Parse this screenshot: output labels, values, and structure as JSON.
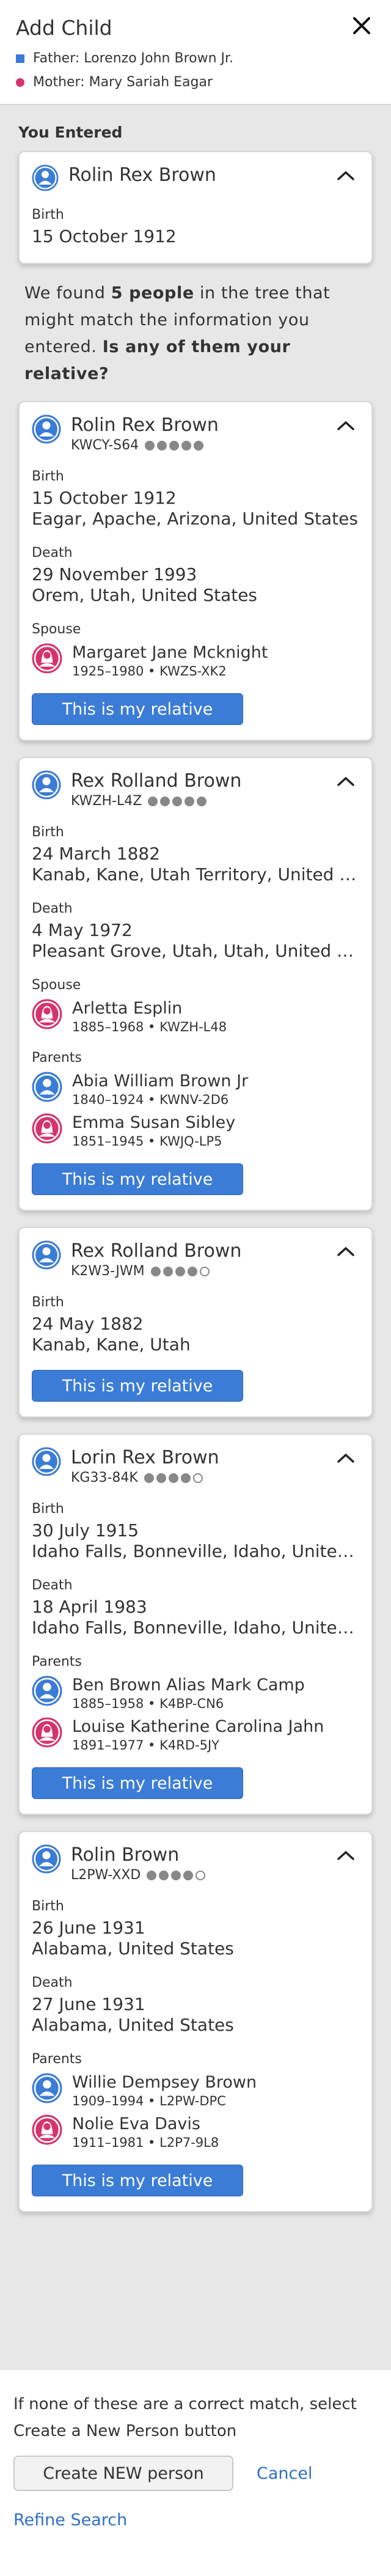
{
  "header": {
    "title": "Add Child",
    "father": "Father: Lorenzo John Brown Jr.",
    "mother": "Mother: Mary Sariah Eagar"
  },
  "entered": {
    "section_label": "You Entered",
    "name": "Rolin Rex Brown",
    "birth_label": "Birth",
    "birth_date": "15 October 1912"
  },
  "found_text": {
    "p1": "We found ",
    "count": "5 people",
    "p2": " in the tree that might match the information you entered. ",
    "question": "Is any of them your relative?"
  },
  "labels": {
    "birth": "Birth",
    "death": "Death",
    "spouse": "Spouse",
    "parents": "Parents",
    "relative_button": "This is my relative",
    "bullet": "•"
  },
  "matches": [
    {
      "name": "Rolin Rex Brown",
      "pid": "KWCY-S64",
      "stars": 5,
      "birth_date": "15 October 1912",
      "birth_place": "Eagar, Apache, Arizona, United States",
      "death_date": "29 November 1993",
      "death_place": "Orem, Utah, United States",
      "spouse": {
        "name": "Margaret Jane Mcknight",
        "years": "1925–1980",
        "pid": "KWZS-XK2"
      }
    },
    {
      "name": "Rex Rolland Brown",
      "pid": "KWZH-L4Z",
      "stars": 5,
      "birth_date": "24 March 1882",
      "birth_place": "Kanab, Kane, Utah Territory, United States",
      "death_date": "4 May 1972",
      "death_place": "Pleasant Grove, Utah, Utah, United States",
      "spouse": {
        "name": "Arletta Esplin",
        "years": "1885–1968",
        "pid": "KWZH-L48"
      },
      "parents": [
        {
          "name": "Abia William Brown Jr",
          "years": "1840–1924",
          "pid": "KWNV-2D6"
        },
        {
          "name": "Emma Susan Sibley",
          "years": "1851–1945",
          "pid": "KWJQ-LP5"
        }
      ]
    },
    {
      "name": "Rex Rolland Brown",
      "pid": "K2W3-JWM",
      "stars": 4,
      "birth_date": "24 May 1882",
      "birth_place": "Kanab, Kane, Utah"
    },
    {
      "name": "Lorin Rex Brown",
      "pid": "KG33-84K",
      "stars": 4,
      "birth_date": "30 July 1915",
      "birth_place": "Idaho Falls, Bonneville, Idaho, United States",
      "death_date": "18 April 1983",
      "death_place": "Idaho Falls, Bonneville, Idaho, United States",
      "parents": [
        {
          "name": "Ben Brown Alias Mark Camp",
          "years": "1885–1958",
          "pid": "K4BP-CN6"
        },
        {
          "name": "Louise Katherine Carolina Jahn",
          "years": "1891–1977",
          "pid": "K4RD-5JY"
        }
      ]
    },
    {
      "name": "Rolin Brown",
      "pid": "L2PW-XXD",
      "stars": 4,
      "birth_date": "26 June 1931",
      "birth_place": "Alabama, United States",
      "death_date": "27 June 1931",
      "death_place": "Alabama, United States",
      "parents": [
        {
          "name": "Willie Dempsey Brown",
          "years": "1909–1994",
          "pid": "L2PW-DPC"
        },
        {
          "name": "Nolie Eva Davis",
          "years": "1911–1981",
          "pid": "L2P7-9L8"
        }
      ]
    }
  ],
  "footer": {
    "note": "If none of these are a correct match, select Create a New Person button",
    "create_button": "Create NEW person",
    "cancel": "Cancel",
    "refine": "Refine Search"
  },
  "colors": {
    "male": "#3b7cd6",
    "female": "#d6336c",
    "link": "#2f6fc9"
  }
}
